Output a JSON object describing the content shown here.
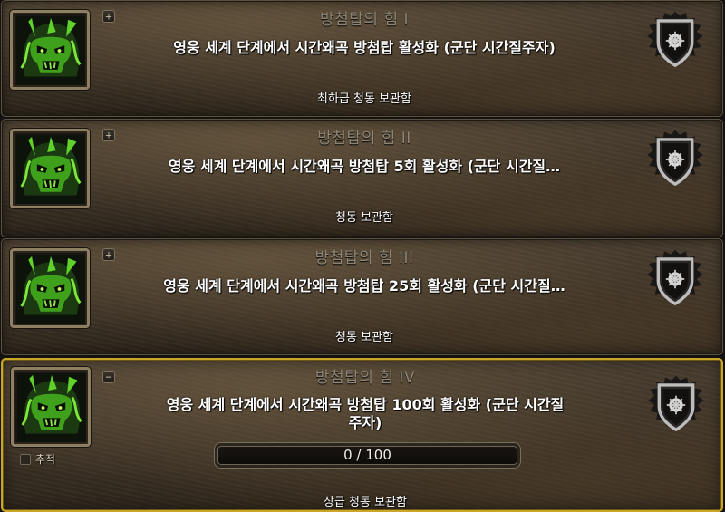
{
  "achievements": [
    {
      "toggle": "+",
      "title": "방첨탑의 힘 I",
      "description": "영웅 세계 단계에서 시간왜곡 방첨탑 활성화 (군단 시간질주자)",
      "reward": "최하급 청동 보관함"
    },
    {
      "toggle": "+",
      "title": "방첨탑의 힘 II",
      "description": "영웅 세계 단계에서 시간왜곡 방첨탑 5회 활성화 (군단 시간질…",
      "reward": "청동 보관함"
    },
    {
      "toggle": "+",
      "title": "방첨탑의 힘 III",
      "description": "영웅 세계 단계에서 시간왜곡 방첨탑 25회 활성화 (군단 시간질…",
      "reward": "청동 보관함"
    },
    {
      "toggle": "−",
      "title": "방첨탑의 힘 IV",
      "description_line1": "영웅 세계 단계에서 시간왜곡 방첨탑 100회 활성화 (군단 시간질",
      "description_line2": "주자)",
      "track_label": "추적",
      "progress": {
        "current": 0,
        "total": 100,
        "text": "0 / 100"
      },
      "reward": "상급 청동 보관함"
    }
  ],
  "icons": {
    "achievement": "green-demon-skull-icon",
    "shield": "guild-shield-emblem-icon",
    "expand": "plus-icon",
    "collapse": "minus-icon"
  },
  "colors": {
    "highlight_border": "#caa628",
    "progress_fill": "#3b7a2a",
    "title_text": "#8c8578"
  }
}
